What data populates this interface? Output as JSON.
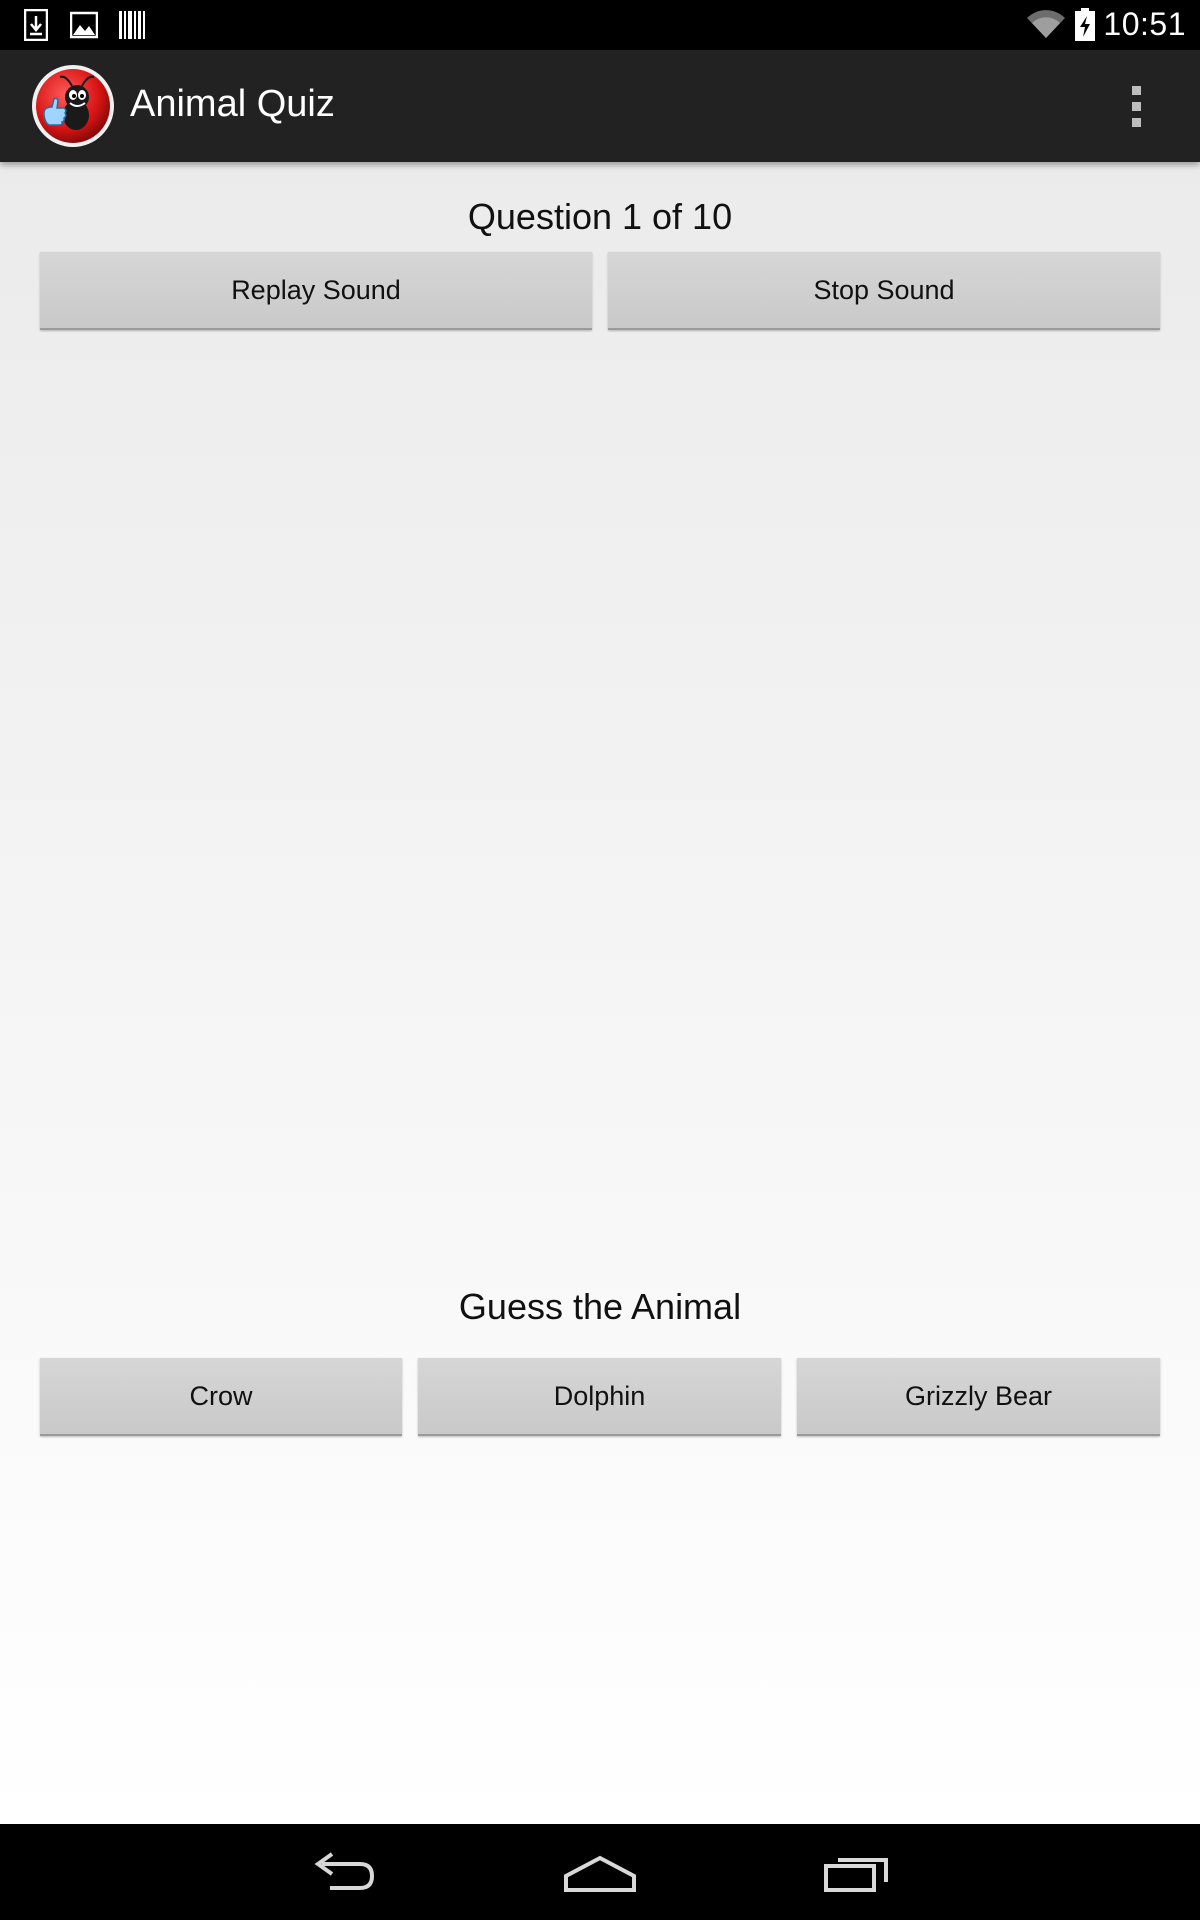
{
  "status_bar": {
    "time": "10:51",
    "icons": [
      "download-icon",
      "image-icon",
      "barcode-icon",
      "wifi-icon",
      "battery-charging-icon"
    ]
  },
  "action_bar": {
    "title": "Animal Quiz",
    "icon": "app-icon",
    "overflow_icon": "overflow-menu-icon"
  },
  "quiz": {
    "question_label": "Question 1 of 10",
    "replay_label": "Replay Sound",
    "stop_label": "Stop Sound",
    "guess_label": "Guess the Animal",
    "choices": [
      "Crow",
      "Dolphin",
      "Grizzly Bear"
    ]
  },
  "nav_bar": {
    "icons": [
      "back-icon",
      "home-icon",
      "recent-apps-icon"
    ]
  },
  "colors": {
    "status_bar": "#000000",
    "action_bar": "#222222",
    "button": "#d0d0d0",
    "app_icon_red": "#e01b1b"
  }
}
